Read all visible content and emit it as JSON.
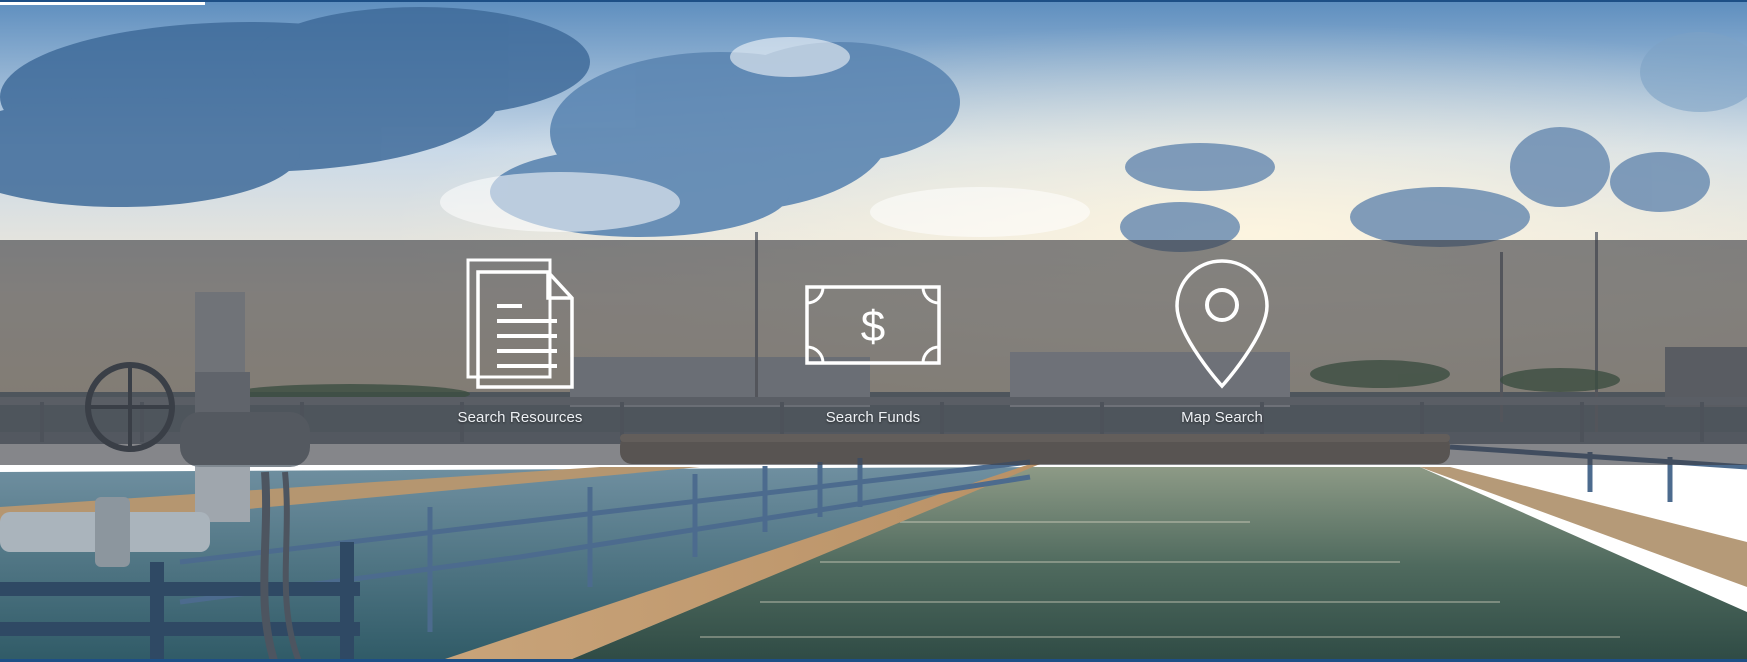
{
  "actions": [
    {
      "label": "Search Resources",
      "icon": "document-icon"
    },
    {
      "label": "Search Funds",
      "icon": "dollar-bill-icon"
    },
    {
      "label": "Map Search",
      "icon": "map-pin-icon"
    }
  ],
  "colors": {
    "frame_border": "#1d4f86",
    "overlay": "#3a3c42",
    "icon_stroke": "#ffffff",
    "label_text": "#eef1f5"
  }
}
